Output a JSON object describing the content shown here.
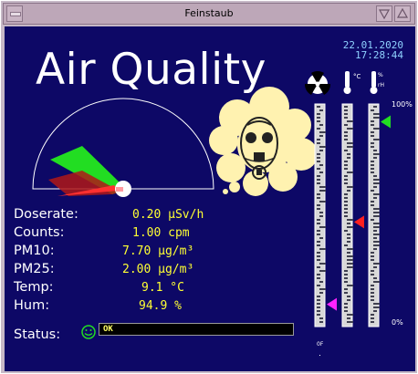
{
  "window": {
    "title": "Feinstaub"
  },
  "header": {
    "headline": "Air Quality",
    "date": "22.01.2020",
    "time": "17:28:44"
  },
  "bars": {
    "icons": [
      "radiation-icon",
      "thermometer-icon",
      "humidity-icon"
    ],
    "max_label": "100%",
    "min_label": "0%",
    "levels": {
      "radiation": 0.1,
      "temperature": 0.47,
      "humidity": 0.92
    }
  },
  "readings": [
    {
      "label": "Doserate:",
      "value": "0.20 µSv/h"
    },
    {
      "label": "Counts:",
      "value": "1.00 cpm"
    },
    {
      "label": "PM10:",
      "value": "7.70 µg/m³"
    },
    {
      "label": "PM25:",
      "value": "2.00 µg/m³"
    },
    {
      "label": "Temp:",
      "value": "9.1 °C"
    },
    {
      "label": "Hum:",
      "value": "94.9 %"
    }
  ],
  "status": {
    "label": "Status:",
    "text": "OK",
    "icon": "smiley-icon"
  },
  "colors": {
    "background": "#0d0866",
    "value_text": "#ffff33",
    "datetime_text": "#8fd1ff",
    "indicator_green": "#22dd22",
    "indicator_red": "#ff2020",
    "indicator_magenta": "#ff22ff",
    "cloud": "#fff2b0"
  }
}
